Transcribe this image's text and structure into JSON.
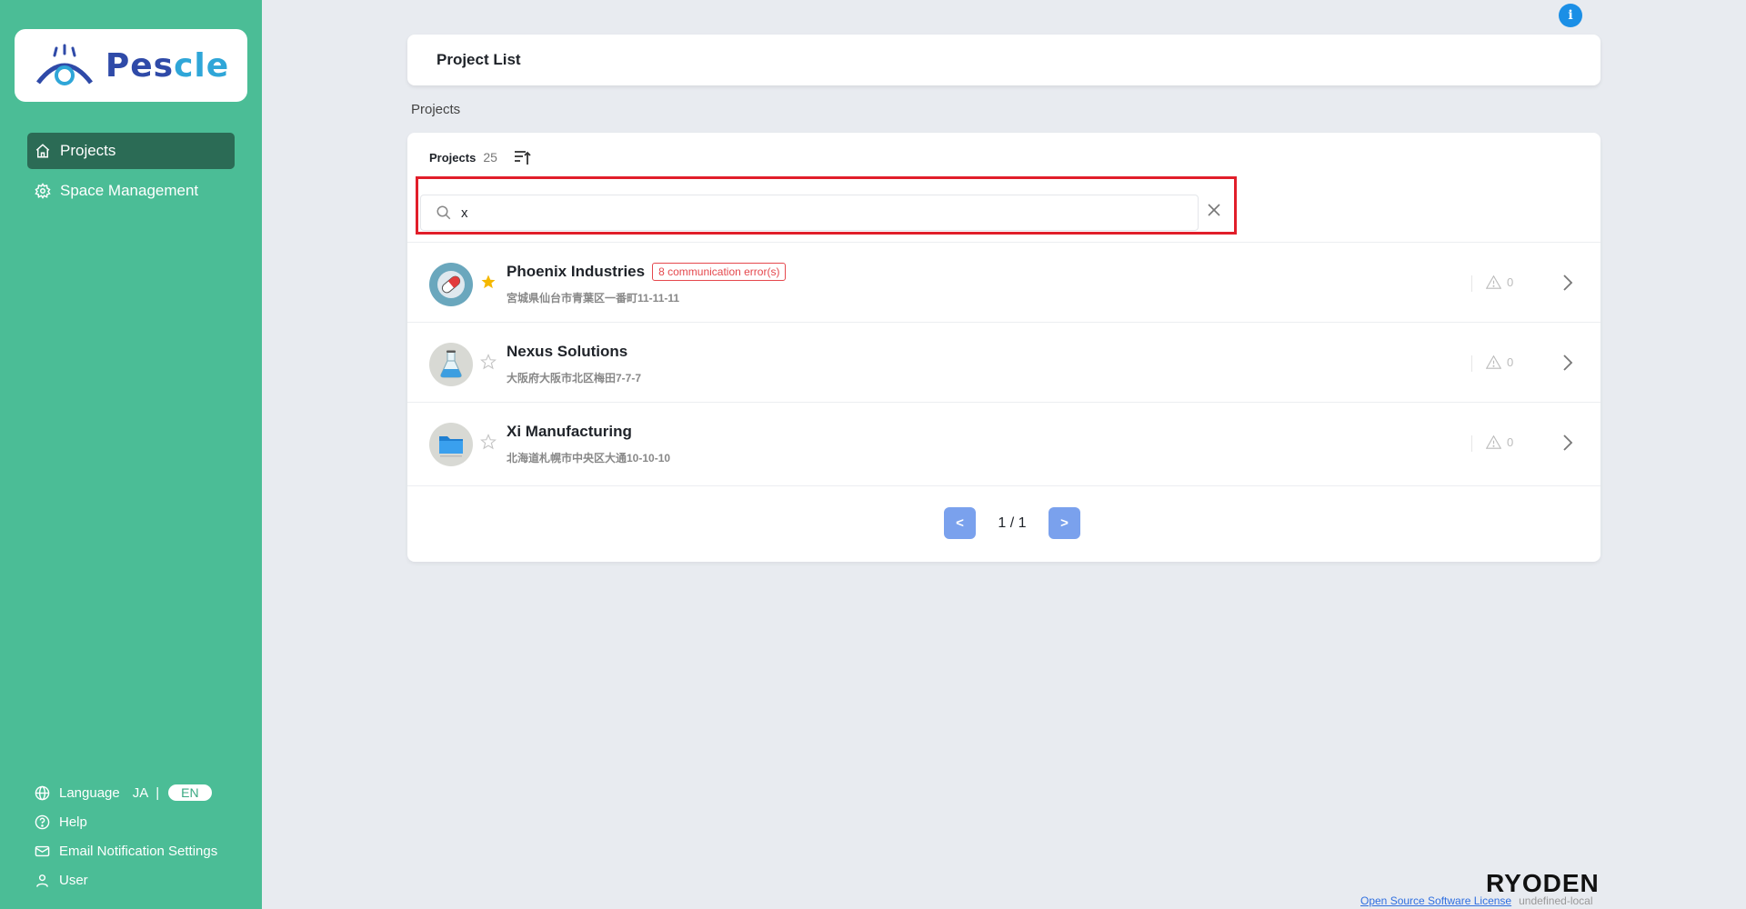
{
  "app": {
    "logo_text_a": "Pes",
    "logo_text_b": "cle"
  },
  "sidebar": {
    "nav": [
      {
        "label": "Projects",
        "icon": "home-icon",
        "active": true
      },
      {
        "label": "Space Management",
        "icon": "gear-icon",
        "active": false
      }
    ],
    "bottom": {
      "language_label": "Language",
      "lang_ja": "JA",
      "lang_sep": "|",
      "lang_en": "EN",
      "help": "Help",
      "email_settings": "Email Notification Settings",
      "user": "User"
    }
  },
  "header": {
    "title": "Project List",
    "info": "i"
  },
  "breadcrumb": "Projects",
  "list": {
    "label": "Projects",
    "count": "25",
    "search_value": "x",
    "rows": [
      {
        "name": "Phoenix Industries",
        "error_badge": "8 communication error(s)",
        "address": "宮城県仙台市青葉区一番町11-11-11",
        "alerts": "0",
        "starred": true,
        "icon": "pill-icon"
      },
      {
        "name": "Nexus Solutions",
        "error_badge": "",
        "address": "大阪府大阪市北区梅田7-7-7",
        "alerts": "0",
        "starred": false,
        "icon": "flask-icon"
      },
      {
        "name": "Xi Manufacturing",
        "error_badge": "",
        "address": "北海道札幌市中央区大通10-10-10",
        "alerts": "0",
        "starred": false,
        "icon": "folder-icon"
      }
    ]
  },
  "pagination": {
    "prev": "<",
    "next": ">",
    "page_text": "1 / 1"
  },
  "footer": {
    "brand": "RYODEN",
    "oss_link": "Open Source Software License",
    "env": "undefined-local"
  },
  "colors": {
    "sidebar_bg": "#4bbd96",
    "nav_active": "#2b6b55",
    "error": "#e5484d",
    "pager": "#7aa1ed",
    "star_active": "#f5b800"
  }
}
